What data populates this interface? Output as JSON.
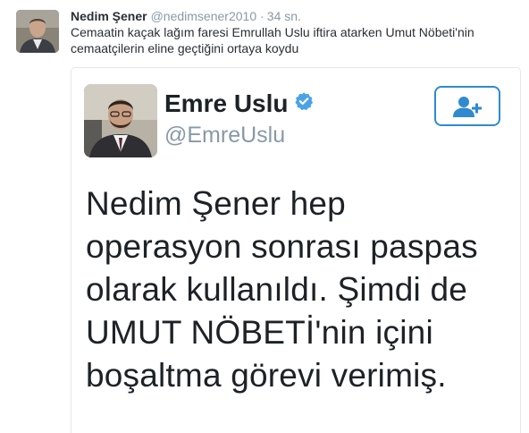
{
  "tweet": {
    "fullname": "Nedim Şener",
    "username": "@nedimsener2010",
    "separator": "·",
    "timestamp": "34 sn.",
    "text_line1": "Cemaatin kaçak lağım faresi Emrullah Uslu iftira atarken Umut Nöbeti'nin",
    "text_line2": "cemaatçilerin eline geçtiğini ortaya koydu"
  },
  "embedded": {
    "fullname": "Emre Uslu",
    "username": "@EmreUslu",
    "verified_icon": "verified-badge-icon",
    "follow_icon": "add-user-icon",
    "lines": [
      "Nedim Şener hep",
      "operasyon sonrası paspas",
      "olarak kullanıldı. Şimdi de",
      "UMUT NÖBETİ'nin içini",
      "boşaltma görevi verimiş."
    ]
  },
  "colors": {
    "accent": "#2f8ad0",
    "muted": "#8899a6",
    "text": "#292f33"
  }
}
